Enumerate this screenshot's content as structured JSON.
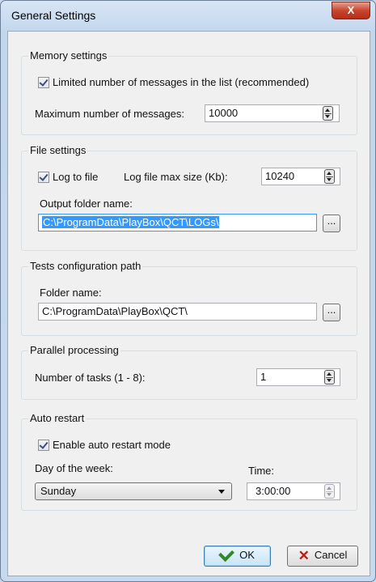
{
  "window": {
    "title": "General Settings",
    "close_label": "X"
  },
  "memory": {
    "legend": "Memory settings",
    "limit_checkbox_label": "Limited number of messages in the list (recommended)",
    "limit_checked": true,
    "max_label": "Maximum number of messages:",
    "max_value": "10000"
  },
  "file": {
    "legend": "File settings",
    "log_checkbox_label": "Log to file",
    "log_checked": true,
    "max_size_label": "Log file max size (Kb):",
    "max_size_value": "10240",
    "output_label": "Output folder name:",
    "output_value": "C:\\ProgramData\\PlayBox\\QCT\\LOGs\\",
    "browse_label": "..."
  },
  "tests": {
    "legend": "Tests configuration path",
    "folder_label": "Folder name:",
    "folder_value": "C:\\ProgramData\\PlayBox\\QCT\\",
    "browse_label": "..."
  },
  "parallel": {
    "legend": "Parallel processing",
    "tasks_label": "Number of tasks (1 - 8):",
    "tasks_value": "1"
  },
  "restart": {
    "legend": "Auto restart",
    "enable_label": "Enable auto restart mode",
    "enable_checked": true,
    "day_label": "Day of the week:",
    "day_value": "Sunday",
    "time_label": "Time:",
    "time_value": "3:00:00"
  },
  "buttons": {
    "ok_label": "OK",
    "cancel_label": "Cancel"
  },
  "icons": {
    "close": "close-icon",
    "ok": "checkmark-icon",
    "cancel": "red-x-icon",
    "spinner": "spinner-arrows-icon",
    "dropdown": "chevron-down-icon"
  }
}
